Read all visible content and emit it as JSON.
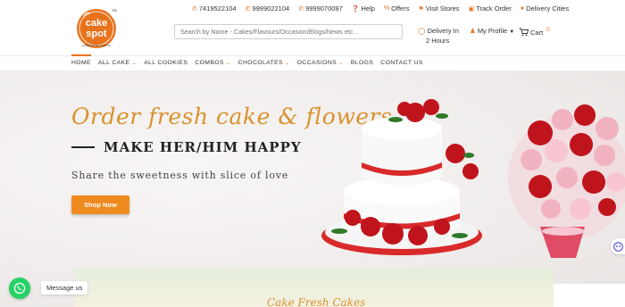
{
  "brand": {
    "logo_line1": "cake",
    "logo_line2": "spot",
    "logo_tm": "TM",
    "logo_tagline": "A PART OF ALL EVENTS",
    "accent_color": "#e8731d"
  },
  "header": {
    "phones": [
      "7419522104",
      "9999022104",
      "9999070097"
    ],
    "links": [
      "Help",
      "Offers",
      "Visit Stores",
      "Track Order",
      "Delivery Cities"
    ],
    "link_icons": [
      "help-icon",
      "offers-icon",
      "store-icon",
      "truck-icon",
      "location-pin-icon"
    ],
    "search_placeholder": "Search by Name - Cakes/Flavours/Occasion/Blogs/News etc...",
    "delivery_line1": "Delivery In",
    "delivery_line2": "2 Hours",
    "profile_label": "My Profile",
    "cart_label": "Cart",
    "cart_count": "0"
  },
  "nav": {
    "items": [
      {
        "label": "HOME",
        "dropdown": false,
        "active": true
      },
      {
        "label": "ALL CAKE",
        "dropdown": true
      },
      {
        "label": "ALL COOKIES",
        "dropdown": false
      },
      {
        "label": "COMBOS",
        "dropdown": true
      },
      {
        "label": "CHOCOLATES",
        "dropdown": true
      },
      {
        "label": "OCCASIONS",
        "dropdown": true
      },
      {
        "label": "BLOGS",
        "dropdown": false
      },
      {
        "label": "CONTACT US",
        "dropdown": false
      }
    ]
  },
  "hero": {
    "tagline": "Order fresh cake & flowers",
    "headline": "MAKE HER/HIM HAPPY",
    "subtext": "Share the sweetness with slice of love",
    "cta_label": "Shop Now",
    "cta_color": "#ef8a1e",
    "band_script": "Cake Fresh Cakes"
  },
  "floating": {
    "whatsapp_label": "Message us",
    "whatsapp_color": "#25d366"
  }
}
